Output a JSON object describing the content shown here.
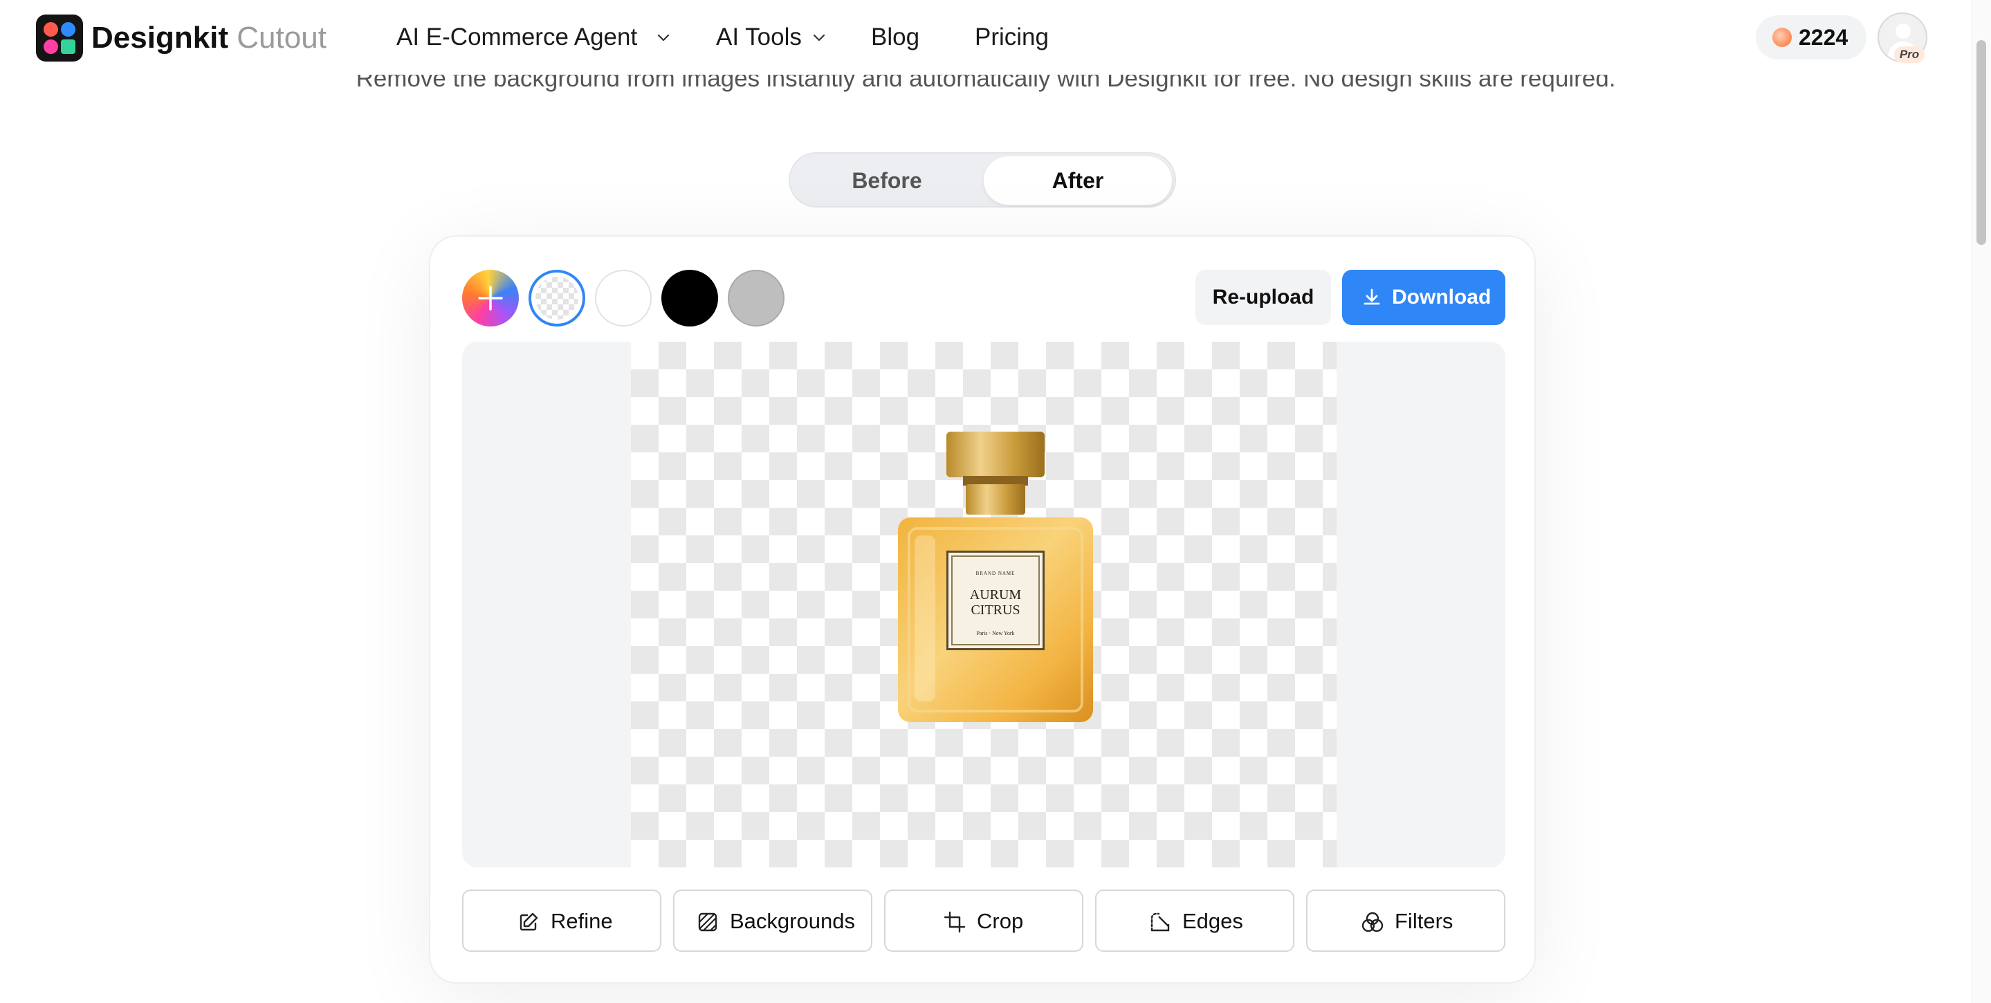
{
  "header": {
    "brand_name": "Designkit",
    "brand_product": "Cutout",
    "nav": [
      {
        "label": "AI E-Commerce Agent",
        "has_dropdown": true
      },
      {
        "label": "AI Tools",
        "has_dropdown": true
      },
      {
        "label": "Blog",
        "has_dropdown": false
      },
      {
        "label": "Pricing",
        "has_dropdown": false
      }
    ],
    "credits": "2224",
    "avatar_badge": "Pro"
  },
  "subtitle": "Remove the background from images instantly and automatically with Designkit for free. No design skills are required.",
  "view_toggle": {
    "options": [
      "Before",
      "After"
    ],
    "selected": "After"
  },
  "background_swatches": [
    {
      "name": "add-custom",
      "icon": "plus-icon"
    },
    {
      "name": "transparent",
      "selected": true
    },
    {
      "name": "white",
      "color": "#ffffff"
    },
    {
      "name": "black",
      "color": "#000000"
    },
    {
      "name": "gray",
      "color": "#bebebe"
    }
  ],
  "actions": {
    "reupload_label": "Re-upload",
    "download_label": "Download"
  },
  "preview": {
    "product_label": {
      "brand": "BRAND NAME",
      "name_line1": "AURUM",
      "name_line2": "CITRUS",
      "cities": "Paris · New York"
    }
  },
  "tools": [
    {
      "label": "Refine",
      "icon": "edit-icon"
    },
    {
      "label": "Backgrounds",
      "icon": "hatch-icon"
    },
    {
      "label": "Crop",
      "icon": "crop-icon"
    },
    {
      "label": "Edges",
      "icon": "edges-icon"
    },
    {
      "label": "Filters",
      "icon": "filters-icon"
    }
  ],
  "colors": {
    "accent": "#2f86f6",
    "coin": "#ff8d5a"
  }
}
